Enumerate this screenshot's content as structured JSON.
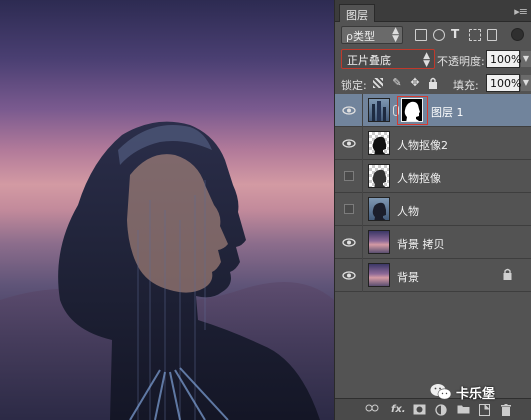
{
  "panel": {
    "tab_label": "图层",
    "menu_glyph": "▸≡"
  },
  "filter": {
    "kind_label": "ρ类型",
    "type_icon": "T"
  },
  "blend": {
    "mode": "正片叠底",
    "opacity_label": "不透明度:",
    "opacity_value": "100%"
  },
  "lock": {
    "label": "锁定:",
    "fill_label": "填充:",
    "fill_value": "100%"
  },
  "layers": [
    {
      "name": "图层 1",
      "visible": true,
      "selected": true,
      "thumb": "photo",
      "has_mask": true,
      "locked": false
    },
    {
      "name": "人物抠像2",
      "visible": true,
      "selected": false,
      "thumb": "checker",
      "has_mask": false,
      "locked": false
    },
    {
      "name": "人物抠像",
      "visible": false,
      "selected": false,
      "thumb": "checker",
      "has_mask": false,
      "locked": false
    },
    {
      "name": "人物",
      "visible": false,
      "selected": false,
      "thumb": "photo",
      "has_mask": false,
      "locked": false
    },
    {
      "name": "背景 拷贝",
      "visible": true,
      "selected": false,
      "thumb": "sky",
      "has_mask": false,
      "locked": false
    },
    {
      "name": "背景",
      "visible": true,
      "selected": false,
      "thumb": "sky",
      "has_mask": false,
      "locked": true
    }
  ],
  "bottom": {
    "fx_label": "fx."
  },
  "watermark": {
    "text": "卡乐堡"
  },
  "colors": {
    "selected_row": "#71849c",
    "highlight_red": "#d63a2f",
    "panel_bg": "#535353"
  }
}
